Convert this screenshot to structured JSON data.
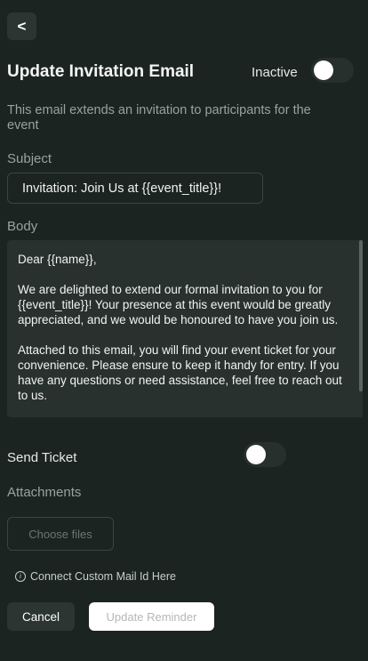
{
  "header": {
    "back_label": "<",
    "title": "Update Invitation Email",
    "status_label": "Inactive",
    "status_enabled": false
  },
  "description": "This email extends an invitation to participants for the event",
  "subject": {
    "label": "Subject",
    "value": "Invitation: Join Us at {{event_title}}!"
  },
  "body": {
    "label": "Body",
    "paragraphs": [
      "Dear {{name}},",
      "We are delighted to extend our formal invitation to you for {{event_title}}! Your presence at this event would be greatly appreciated, and we would be honoured to have you join us.",
      "Attached to this email, you will find your event ticket for your convenience. Please ensure to keep it handy for entry. If you have any questions or need assistance, feel free to reach out to us."
    ]
  },
  "send_ticket": {
    "label": "Send Ticket",
    "enabled": false
  },
  "attachments": {
    "label": "Attachments",
    "choose_files_label": "Choose files"
  },
  "connect_mail_link": "Connect Custom Mail Id Here",
  "footer": {
    "cancel_label": "Cancel",
    "update_label": "Update Reminder"
  },
  "colors": {
    "background": "#1b2420",
    "panel": "#28312e",
    "button_dark": "#2b3532",
    "button_light": "#ffffff",
    "muted_text": "#9aa29f"
  }
}
